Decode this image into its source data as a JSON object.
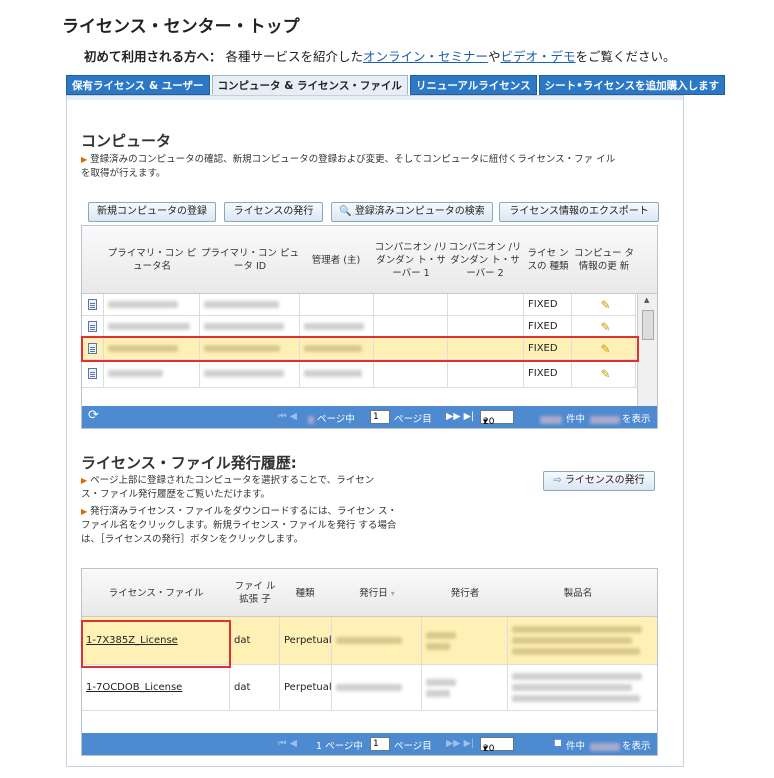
{
  "page": {
    "title": "ライセンス・センター・トップ"
  },
  "intro": {
    "bold": "初めて利用される方へ：",
    "text1": " 各種サービスを紹介した",
    "link1": "オンライン・セミナー",
    "mid": "や",
    "link2": "ビデオ・デモ",
    "text2": "をご覧ください。"
  },
  "tabs": [
    "保有ライセンス & ユーザー",
    "コンピュータ & ライセンス・ファイル",
    "リニューアルライセンス",
    "シート•ライセンスを追加購入します"
  ],
  "computers": {
    "title": "コンピュータ",
    "desc": "登録済みのコンピュータの確認、新規コンピュータの登録および変更、そしてコンピュータに紐付くライセンス・ファ イルを取得が行えます。",
    "buttons": {
      "register": "新規コンピュータの登録",
      "issue": "ライセンスの発行",
      "search": "登録済みコンピュータの検索",
      "export": "ライセンス情報のエクスポート"
    },
    "headers": {
      "primary_name": "プライマリ・コン ピュータ名",
      "primary_id": "プライマリ・コン ピュータ ID",
      "admin": "管理者 (主)",
      "companion1": "コンパニオン /リダンダン ト・サーバー 1",
      "companion2": "コンパニオン /リダンダン ト・サーバー 2",
      "license_type": "ライセ ンスの 種類",
      "update": "コンピュー タ情報の更 新"
    },
    "rows": [
      {
        "type": "FIXED"
      },
      {
        "type": "FIXED"
      },
      {
        "type": "FIXED"
      },
      {
        "type": "FIXED"
      }
    ],
    "pager": {
      "page_of": "ページ中",
      "page_num": "1",
      "page_label": "ページ目",
      "per_page": "20",
      "count_suffix": "件中",
      "show": "を表示"
    }
  },
  "history": {
    "title": "ライセンス・ファイル発行履歴:",
    "desc1": "ページ上部に登録されたコンピュータを選択することで、ライセン ス・ファイル発行履歴をご覧いただけます。",
    "desc2": "発行済みライセンス・ファイルをダウンロードするには、ライセン ス・ファイル名をクリックします。新規ライセンス・ファイルを発行 する場合は、［ライセンスの発行］ボタンをクリックします。",
    "issue_button": "ライセンスの発行",
    "headers": {
      "file": "ライセンス・ファイル",
      "ext": "ファイ ル拡張 子",
      "kind": "種類",
      "date": "発行日",
      "issuer": "発行者",
      "product": "製品名"
    },
    "rows": [
      {
        "file": "1-7X385Z_License",
        "ext": "dat",
        "kind": "Perpetual"
      },
      {
        "file": "1-7OCDOB_License",
        "ext": "dat",
        "kind": "Perpetual"
      }
    ],
    "pager": {
      "page_of": "1 ページ中",
      "page_num": "1",
      "page_label": "ページ目",
      "per_page": "20",
      "count_prefix": "件中",
      "show": "を表示"
    }
  }
}
